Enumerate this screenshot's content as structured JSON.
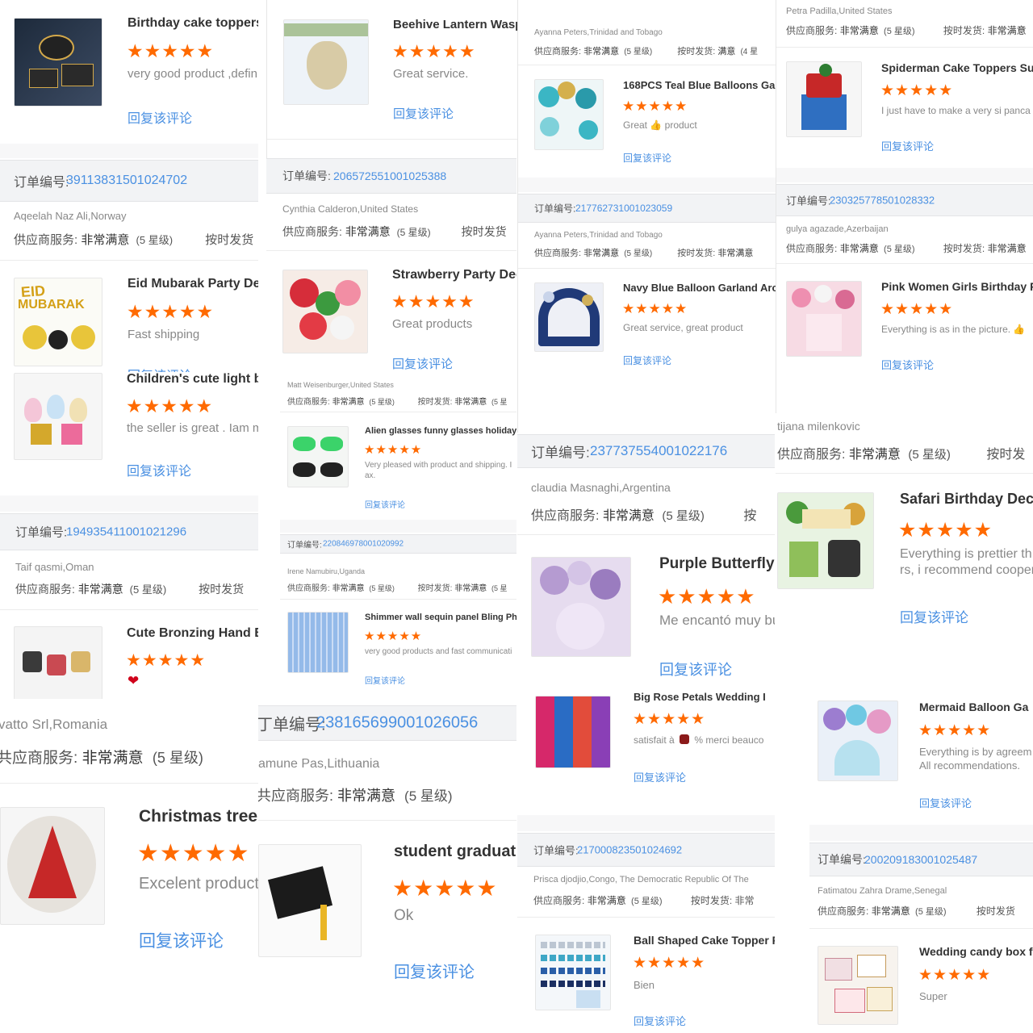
{
  "common": {
    "order_label": "订单编号:",
    "service_label": "供应商服务:",
    "service_value": "非常满意",
    "rating": "(5 星级)",
    "ontime_label": "按时发货",
    "ontime_short": "按时发货:",
    "ontime_value": "非常满意",
    "ontime_value_ok": "满意",
    "ontime_rating_4": "(4 星",
    "ontime_rating_5": "(5 星",
    "reply": "回复该评论",
    "stars": "★★★★★",
    "heart": "❤"
  },
  "col1": {
    "r1": {
      "title": "Birthday cake toppers fo",
      "text": "very good product ,defin"
    },
    "o1": {
      "order": "391138315010247​02",
      "buyer": "Aqeelah Naz Ali,Norway"
    },
    "r2": {
      "title": "Eid Mubarak Party Deco",
      "text": "Fast shipping"
    },
    "r3": {
      "title": "Children's cute light bu",
      "text": "the seller is great . Iam m",
      "overlap": "回复该评论"
    },
    "o2": {
      "order": "194935411001021296",
      "buyer": "Taif qasmi,Oman"
    },
    "r4": {
      "title": "Cute Bronzing Hand B"
    },
    "o3": {
      "buyer": "vatto Srl,Romania",
      "service_prefix": "共应商服务:"
    },
    "r5": {
      "title": "Christmas tree",
      "text": "Excelent product"
    }
  },
  "col2": {
    "r1": {
      "title": "Beehive Lantern Wasp D",
      "text": "Great service."
    },
    "o1": {
      "order": "206572551001025388",
      "buyer": "Cynthia Calderon,United States"
    },
    "r2": {
      "title": "Strawberry Party Dec",
      "text": "Great products"
    },
    "o2": {
      "buyer": "Matt Weisenburger,United States"
    },
    "r3": {
      "title": "Alien glasses funny glasses holiday",
      "text": "Very pleased with product and shipping. I",
      "text2": "ax."
    },
    "o3": {
      "order": "220846978001020992",
      "buyer": "Irene Namubiru,Uganda"
    },
    "r4": {
      "title": "Shimmer wall sequin panel Bling Ph",
      "text": "very good products and fast communicati"
    },
    "o4": {
      "order_prefix": "丁单编号:",
      "order": "238165699001026056",
      "buyer": "amune Pas,Lithuania",
      "service_prefix": "共应商服务:"
    },
    "r5": {
      "title": "student graduat",
      "text": "Ok"
    }
  },
  "col3": {
    "o0": {
      "buyer": "Ayanna Peters,Trinidad and Tobago"
    },
    "r1": {
      "title": "168PCS Teal Blue Balloons Garl",
      "text_a": "Great",
      "text_b": "product",
      "thumb": "👍"
    },
    "o1": {
      "order": "217762731001023059",
      "buyer": "Ayanna Peters,Trinidad and Tobago"
    },
    "r2": {
      "title": "Navy Blue Balloon Garland Arch",
      "text": "Great service, great product"
    },
    "o2": {
      "order": "237737554001022176",
      "buyer": "claudia Masnaghi,Argentina",
      "ontime_cut": "按"
    },
    "r3": {
      "title": "Purple Butterfly I",
      "text": "Me encantó muy bu"
    },
    "r4": {
      "title": "Big Rose Petals Wedding I",
      "text_a": "satisfait à",
      "text_b": "% merci beauco"
    },
    "o3": {
      "order": "217000823501024692",
      "buyer": "Prisca djodjio,Congo, The Democratic Republic Of The",
      "ontime_cut": "按时发货: 非常"
    },
    "r5": {
      "title": "Ball Shaped Cake Topper F",
      "text": "Bien"
    }
  },
  "col4": {
    "o0": {
      "buyer": "Petra Padilla,United States"
    },
    "r1": {
      "title": "Spiderman Cake Toppers Sup",
      "text": "I just have to make a very si panca"
    },
    "o1": {
      "order": "230325778501028332",
      "buyer": "gulya agazade,Azerbaijan"
    },
    "r2": {
      "title": "Pink Women Girls Birthday Pr",
      "text": "Everything is as in the picture.",
      "thumb": "👍"
    },
    "o2": {
      "buyer": "tijana milenkovic",
      "ontime_cut": "按时发"
    },
    "r3": {
      "title": "Safari Birthday Deco",
      "text": "Everything is prettier th",
      "text2": "rs, i recommend cooper"
    },
    "r4": {
      "title": "Mermaid Balloon Ga",
      "text": "Everything is by agreem",
      "text2": "All recommendations."
    },
    "o3": {
      "order": "200209183001025487",
      "buyer": "Fatimatou Zahra Drame,Senegal"
    },
    "r5": {
      "title": "Wedding candy box f",
      "text": "Super"
    }
  },
  "colors": {
    "link": "#4a90e2",
    "stars": "#ff6a00",
    "bar": "#f2f3f5"
  }
}
